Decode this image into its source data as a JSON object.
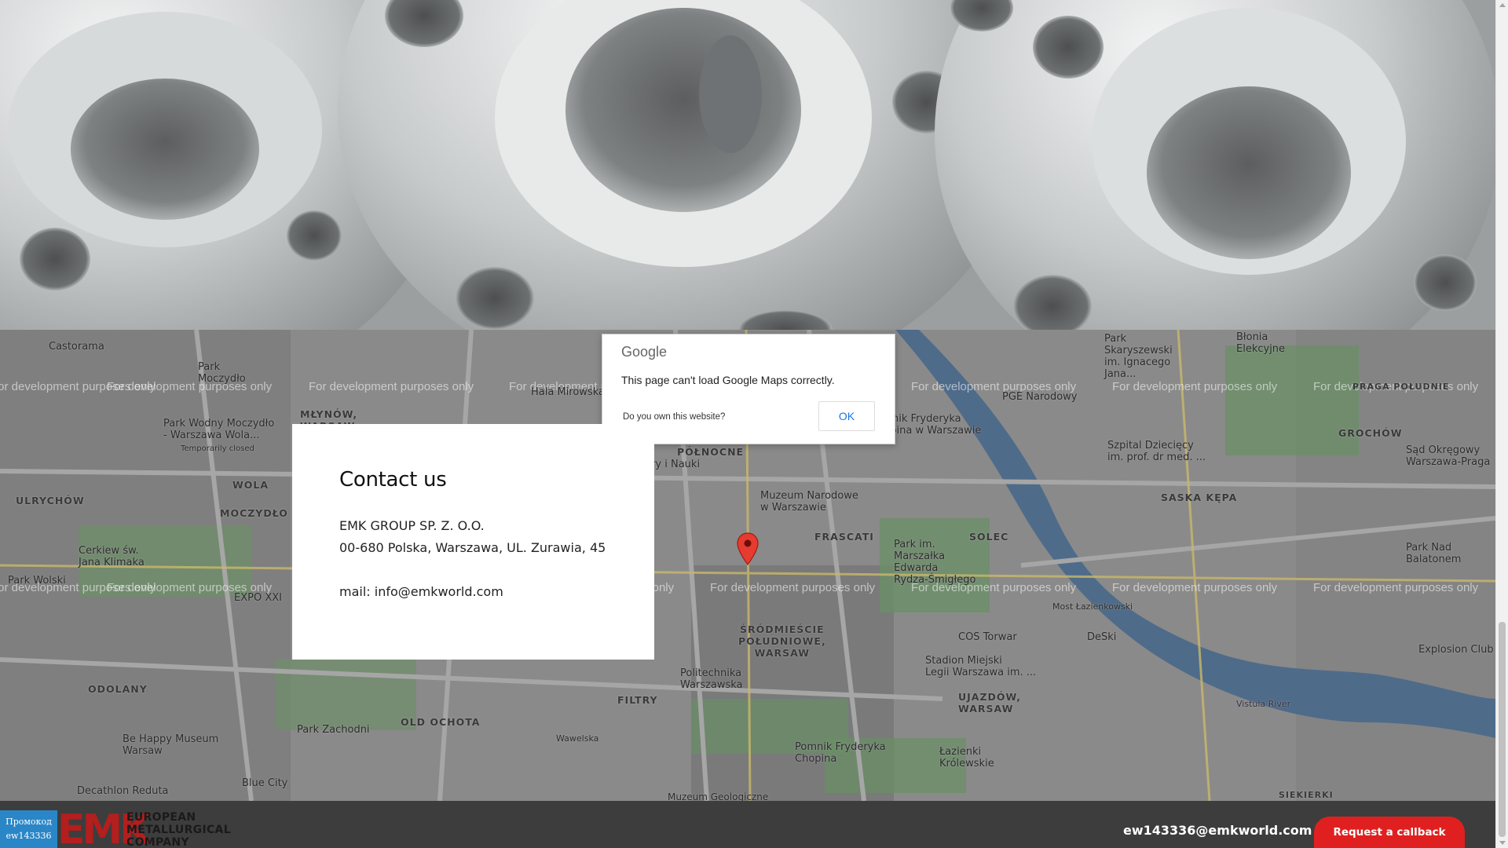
{
  "map": {
    "dialog": {
      "logo_text": "Google",
      "message": "This page can't load Google Maps correctly.",
      "own_site": "Do you own this website?",
      "ok_label": "OK"
    },
    "watermark": "For development purposes only",
    "labels": {
      "castorama": "Castorama",
      "park_moczydlo": "Park\nMoczydło",
      "mlynow": "MŁYNÓW,\nWARSAW",
      "hala_mirowska": "Hala Mirowska",
      "park_wodny": "Park Wodny Moczydło\n- Warszawa Wola...",
      "temp_closed": "Temporarily closed",
      "wola": "WOLA",
      "ulrychow": "ULRYCHÓW",
      "moczydlo": "MOCZYDŁO",
      "cerkiew": "Cerkiew św.\nJana Klimaka",
      "park_wolski": "Park Wolski",
      "expo": "EXPO XXI",
      "odolany": "ODOLANY",
      "be_happy": "Be Happy Museum\nWarsaw",
      "park_zachodni": "Park Zachodni",
      "old_ochota": "OLD OCHOTA",
      "filtry": "FILTRY",
      "decathlon": "Decathlon Reduta",
      "blue_city": "Blue City",
      "muzeum_geo": "Muzeum Geologiczne",
      "polnocne": "PÓŁNOCNE",
      "kultury": "Kultury i Nauki",
      "muzeum_nar": "Muzeum Narodowe\nw Warszawie",
      "frascati": "FRASCATI",
      "srodmiescie": "ŚRÓDMIEŚCIE\nPOŁUDNIOWE,\nWARSAW",
      "politechnika": "Politechnika\nWarszawska",
      "pomnik": "Pomnik Fryderyka\nChopina",
      "lazienki": "Łazienki\nKrólewskie",
      "ujazdow": "UJAZDÓW,\nWARSAW",
      "solec": "SOLEC",
      "park_marszalka": "Park im.\nMarszałka\nEdwarda\nRydza-Śmigłego",
      "park_skaryszewski": "Park\nSkaryszewski\nim. Ignacego\nJana...",
      "pge": "PGE Narodowy",
      "blonia": "Błonia\nElekcyjne",
      "praga": "PRAGA POŁUDNIE",
      "grochow": "GROCHÓW",
      "szpital": "Szpital Dziecięcy\nim. prof. dr med. ...",
      "sad": "Sąd Okręgowy\nWarszawa-Praga",
      "saska": "SASKA KĘPA",
      "park_balatonem": "Park Nad\nBalatonem",
      "most": "Most Łazienkowski",
      "cos": "COS Torwar",
      "stadion": "Stadion Miejski\nLegii Warszawa im. ...",
      "deski": "DeSki",
      "explosion": "Explosion Club",
      "siekierki": "SIEKIERKI",
      "vistula": "Vistula River",
      "pomnik_fryderyka_n": "Pomnik Fryderyka\nChopina w Warszawie",
      "waweiska": "Wawelska"
    }
  },
  "contact": {
    "title": "Contact us",
    "company": "EMK GROUP SP. Z. O.O.",
    "address": "00-680 Polska, Warszawa, UL. Zurawia, 45",
    "mail_prefix": "mail: ",
    "mail": "info@emkworld.com"
  },
  "footer": {
    "promo_label": "Промокод",
    "promo_code": "ew143336",
    "logo_mark": "EMK",
    "logo_line1": "EUROPEAN",
    "logo_line2": "METALLURGICAL",
    "logo_line3": "COMPANY",
    "email": "ew143336@emkworld.com",
    "callback_label": "Request a callback"
  },
  "colors": {
    "accent_red": "#e02020",
    "promo_blue": "#2a86c7",
    "footer_bg": "#3d3d3d"
  }
}
